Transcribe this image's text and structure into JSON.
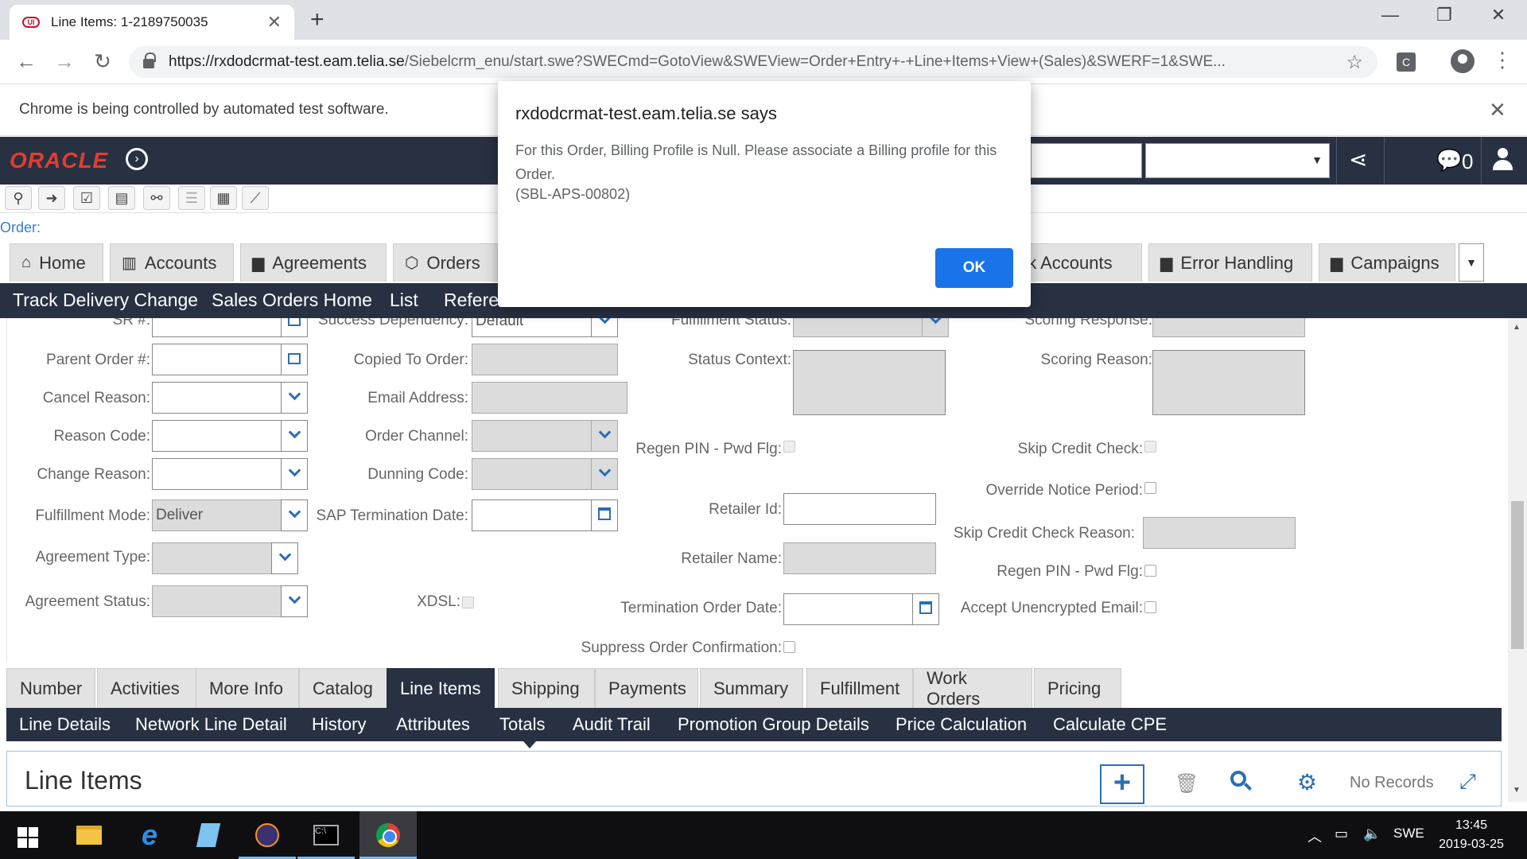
{
  "browser": {
    "tab_title": "Line Items: 1-2189750035",
    "favicon_text": "UI",
    "url_host": "https://rxdodcrmat-test.eam.telia.se",
    "url_path": "/Siebelcrm_enu/start.swe?SWECmd=GotoView&SWEView=Order+Entry+-+Line+Items+View+(Sales)&SWERF=1&SWE...",
    "infobar_text": "Chrome is being controlled by automated test software.",
    "extension_letter": "C"
  },
  "app": {
    "logo": "ORACLE",
    "notification_count": "0",
    "order_label": "Order:",
    "screen_tabs": [
      {
        "label": "Home",
        "icon": "home-icon"
      },
      {
        "label": "Accounts",
        "icon": "building-icon"
      },
      {
        "label": "Agreements",
        "icon": "document-icon"
      },
      {
        "label": "Orders",
        "icon": "box-icon"
      },
      {
        "label": "Bulk Accounts",
        "icon": "document-icon"
      },
      {
        "label": "Error Handling",
        "icon": "document-icon"
      },
      {
        "label": "Campaigns",
        "icon": "document-icon"
      }
    ],
    "view_links": [
      "Track Delivery Change",
      "Sales Orders Home",
      "List",
      "Refere"
    ]
  },
  "form": {
    "sr": {
      "label": "SR #:",
      "value": ""
    },
    "parent_order": {
      "label": "Parent Order #:",
      "value": ""
    },
    "cancel_reason": {
      "label": "Cancel Reason:",
      "value": ""
    },
    "reason_code": {
      "label": "Reason Code:",
      "value": ""
    },
    "change_reason": {
      "label": "Change Reason:",
      "value": ""
    },
    "fulfillment_mode": {
      "label": "Fulfillment Mode:",
      "value": "Deliver"
    },
    "agreement_type": {
      "label": "Agreement Type:",
      "value": ""
    },
    "agreement_status": {
      "label": "Agreement Status:",
      "value": ""
    },
    "success_dependency": {
      "label": "Success Dependency:",
      "value": "Default"
    },
    "copied_to_order": {
      "label": "Copied To Order:",
      "value": ""
    },
    "email_address": {
      "label": "Email Address:",
      "value": ""
    },
    "order_channel": {
      "label": "Order Channel:",
      "value": ""
    },
    "dunning_code": {
      "label": "Dunning Code:",
      "value": ""
    },
    "sap_termination_date": {
      "label": "SAP Termination Date:",
      "value": ""
    },
    "xdsl": {
      "label": "XDSL:"
    },
    "fulfillment_status": {
      "label": "Fulfillment Status:",
      "value": ""
    },
    "status_context": {
      "label": "Status Context:"
    },
    "regen_pin_1": {
      "label": "Regen PIN - Pwd Flg:"
    },
    "retailer_id": {
      "label": "Retailer Id:",
      "value": ""
    },
    "retailer_name": {
      "label": "Retailer Name:",
      "value": ""
    },
    "termination_order_date": {
      "label": "Termination Order Date:",
      "value": ""
    },
    "suppress_order_confirmation": {
      "label": "Suppress Order Confirmation:"
    },
    "scoring_response": {
      "label": "Scoring Response:",
      "value": ""
    },
    "scoring_reason": {
      "label": "Scoring Reason:"
    },
    "skip_credit_check": {
      "label": "Skip Credit Check:"
    },
    "override_notice_period": {
      "label": "Override Notice Period:"
    },
    "skip_credit_check_reason": {
      "label": "Skip Credit Check Reason:",
      "value": ""
    },
    "regen_pin_2": {
      "label": "Regen PIN - Pwd Flg:"
    },
    "accept_unencrypted_email": {
      "label": "Accept Unencrypted Email:"
    }
  },
  "sub_tabs": [
    "Number",
    "Activities",
    "More Info",
    "Catalog",
    "Line Items",
    "Shipping",
    "Payments",
    "Summary",
    "Fulfillment",
    "Work Orders",
    "Pricing"
  ],
  "active_sub_tab": "Line Items",
  "detail_links": [
    "Line Details",
    "Network Line Detail",
    "History",
    "Attributes",
    "Totals",
    "Audit Trail",
    "Promotion Group Details",
    "Price Calculation",
    "Calculate CPE"
  ],
  "list_applet": {
    "title": "Line Items",
    "records": "No Records"
  },
  "dialog": {
    "title": "rxdodcrmat-test.eam.telia.se says",
    "message": "For this Order, Billing Profile is Null. Please associate a Billing profile for this Order.",
    "code": "(SBL-APS-00802)",
    "ok_label": "OK"
  },
  "taskbar": {
    "language": "SWE",
    "time": "13:45",
    "date": "2019-03-25"
  },
  "colors": {
    "siebel_dark": "#273142",
    "accent_blue": "#2a6fb4",
    "chrome_blue": "#1a73e8",
    "oracle_red": "#e73b2e"
  }
}
